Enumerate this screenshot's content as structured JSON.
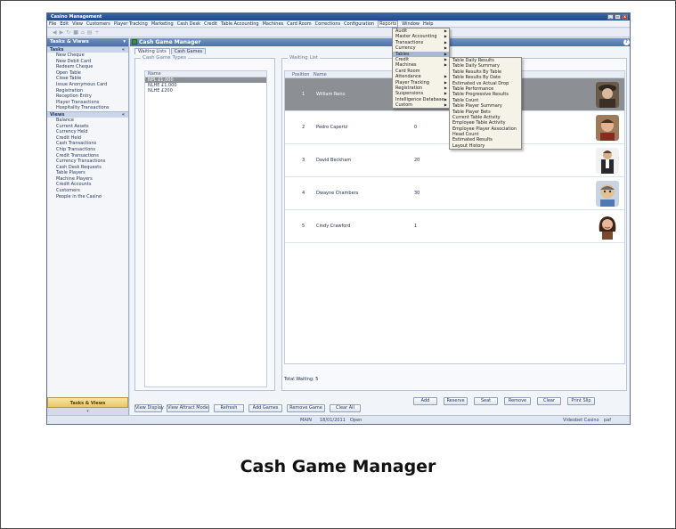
{
  "caption": "Cash Game Manager",
  "app": {
    "title": "Casino Management",
    "window_buttons": [
      "_",
      "▫",
      "x"
    ]
  },
  "menubar": [
    "File",
    "Edit",
    "View",
    "Customers",
    "Player Tracking",
    "Marketing",
    "Cash Desk",
    "Credit",
    "Table Accounting",
    "Machines",
    "Card Room",
    "Corrections",
    "Configuration",
    "Reports",
    "Window",
    "Help"
  ],
  "active_menu_index": 13,
  "toolbar_icons": [
    "back-icon",
    "forward-icon",
    "refresh-icon",
    "stop-icon",
    "home-icon",
    "print-icon",
    "add-icon"
  ],
  "left_panel": {
    "title": "Tasks & Views",
    "tasks_header": "Tasks",
    "tasks": [
      "New Cheque",
      "New Debit Card",
      "Redeem Cheque",
      "Open Table",
      "Close Table",
      "Issue Anonymous Card",
      "Registration",
      "Reception Entry",
      "Player Transactions",
      "Hospitality Transactions"
    ],
    "views_header": "Views",
    "views": [
      "Balance",
      "Current Assets",
      "Currency Held",
      "Credit Held",
      "Cash Transactions",
      "Chip Transactions",
      "Credit Transactions",
      "Currency Transactions",
      "Cash Desk Requests",
      "Table Players",
      "Machine Players",
      "Credit Accounts",
      "Customers",
      "People in the Casino"
    ],
    "bottom_button": "Tasks & Views"
  },
  "document": {
    "title": "Cash Game Manager",
    "tabs": [
      "Waiting Lists",
      "Cash Games"
    ],
    "selected_tab": 0,
    "game_types": {
      "label": "Cash Game Types",
      "column": "Name",
      "rows": [
        "NPL £1,000",
        "NLHE £1,000",
        "NLHE £200"
      ],
      "selected_row": 0
    },
    "waiting_list": {
      "label": "Waiting List",
      "columns": [
        "Position",
        "Name"
      ],
      "rows": [
        {
          "position": "1",
          "name": "William Reno",
          "value": ""
        },
        {
          "position": "2",
          "name": "Pedro Capertz",
          "value": "0"
        },
        {
          "position": "3",
          "name": "David Beckham",
          "value": "20"
        },
        {
          "position": "4",
          "name": "Dwayne Chambers",
          "value": "30"
        },
        {
          "position": "5",
          "name": "Cindy Crawford",
          "value": "1"
        }
      ],
      "selected_row": 0,
      "total_label": "Total Waiting: 5"
    },
    "wl_buttons": [
      "Add",
      "Reserve",
      "Seat",
      "Remove",
      "Clear",
      "Print Slip"
    ],
    "bottom_buttons": [
      "View Display",
      "View Attract Mode",
      "Refresh",
      "Add Games",
      "Remove Game",
      "Clear All"
    ]
  },
  "open_docs": [
    "Manage Tables",
    "Table Estimates Summary",
    "Find Player Rating - ...t Gaming Casino",
    "Cash Game Manager"
  ],
  "selected_doc": 3,
  "status": {
    "site": "MAIN",
    "date": "18/01/2011",
    "state": "Open",
    "casino": "Videobet Casino",
    "user": "paf"
  },
  "reports_menu": [
    "Audit",
    "Master Accounting",
    "Transactions",
    "Currency",
    "Tables",
    "Credit",
    "Machines",
    "Card Room",
    "Attendance",
    "Player Tracking",
    "Registration",
    "Suspensions",
    "Intelligence Database",
    "Custom"
  ],
  "reports_menu_arrows": [
    true,
    true,
    true,
    true,
    true,
    true,
    true,
    false,
    true,
    true,
    true,
    true,
    true,
    true
  ],
  "reports_highlight": 4,
  "tables_submenu": [
    "Table Daily Results",
    "Table Daily Summary",
    "Table Results By Table",
    "Table Results By Date",
    "Estimated vs Actual Drop",
    "Table Performance",
    "Table Progressive Results",
    "Table Count",
    "Table Player Summary",
    "Table Player Bets",
    "Current Table Activity",
    "Employee Table Activity",
    "Employee Player Association",
    "Head Count",
    "Estimated Results",
    "Layout History"
  ]
}
